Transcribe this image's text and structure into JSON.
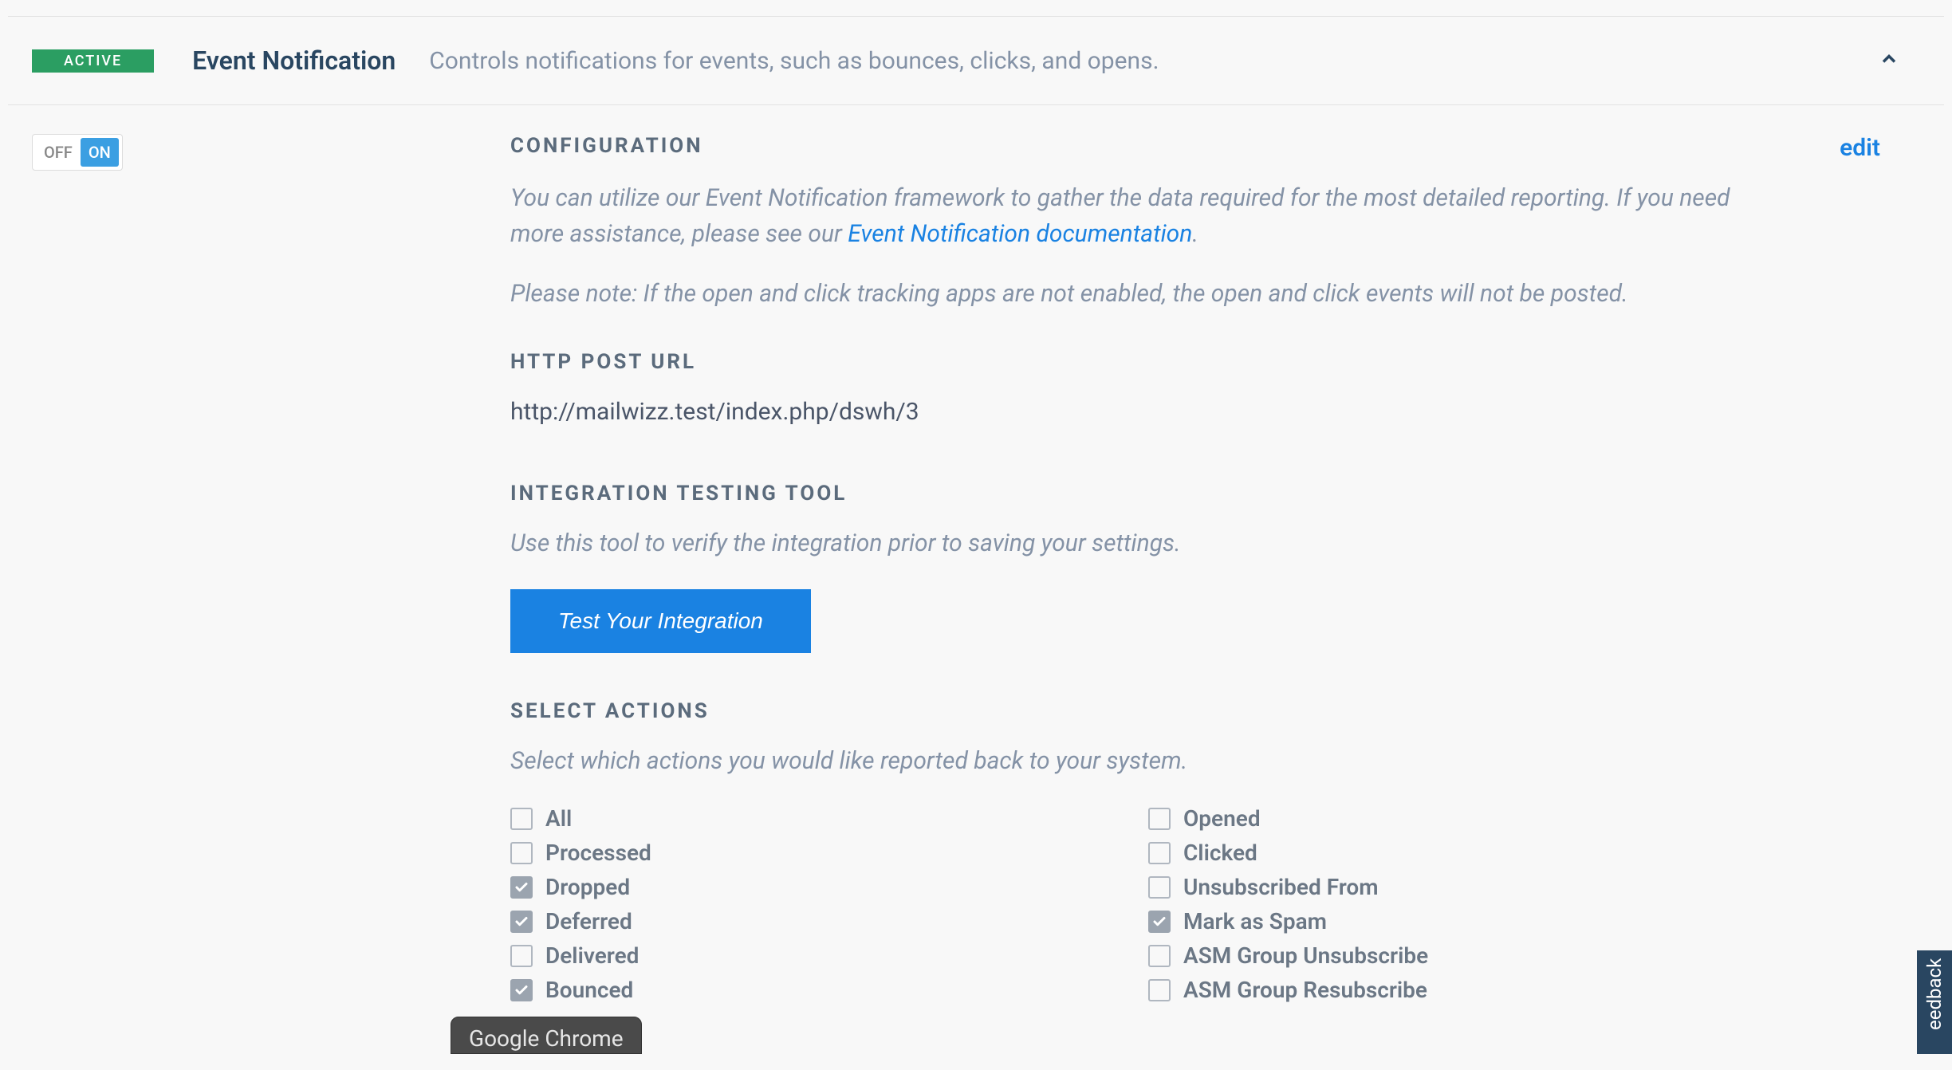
{
  "header": {
    "badge": "ACTIVE",
    "title": "Event Notification",
    "description": "Controls notifications for events, such as bounces, clicks, and opens."
  },
  "toggle": {
    "off": "OFF",
    "on": "ON"
  },
  "config": {
    "title": "CONFIGURATION",
    "edit": "edit",
    "desc_part1": "You can utilize our Event Notification framework to gather the data required for the most detailed reporting. If you need more assistance, please see our ",
    "desc_link": "Event Notification documentation",
    "desc_part2": ".",
    "note": "Please note: If the open and click tracking apps are not enabled, the open and click events will not be posted."
  },
  "post_url": {
    "title": "HTTP POST URL",
    "value": "http://mailwizz.test/index.php/dswh/3"
  },
  "testing": {
    "title": "INTEGRATION TESTING TOOL",
    "desc": "Use this tool to verify the integration prior to saving your settings.",
    "button": "Test Your Integration"
  },
  "actions": {
    "title": "SELECT ACTIONS",
    "desc": "Select which actions you would like reported back to your system.",
    "left": [
      {
        "label": "All",
        "checked": false
      },
      {
        "label": "Processed",
        "checked": false
      },
      {
        "label": "Dropped",
        "checked": true
      },
      {
        "label": "Deferred",
        "checked": true
      },
      {
        "label": "Delivered",
        "checked": false
      },
      {
        "label": "Bounced",
        "checked": true
      }
    ],
    "right": [
      {
        "label": "Opened",
        "checked": false
      },
      {
        "label": "Clicked",
        "checked": false
      },
      {
        "label": "Unsubscribed From",
        "checked": false
      },
      {
        "label": "Mark as Spam",
        "checked": true
      },
      {
        "label": "ASM Group Unsubscribe",
        "checked": false
      },
      {
        "label": "ASM Group Resubscribe",
        "checked": false
      }
    ]
  },
  "feedback": "eedback",
  "chrome": "Google Chrome"
}
